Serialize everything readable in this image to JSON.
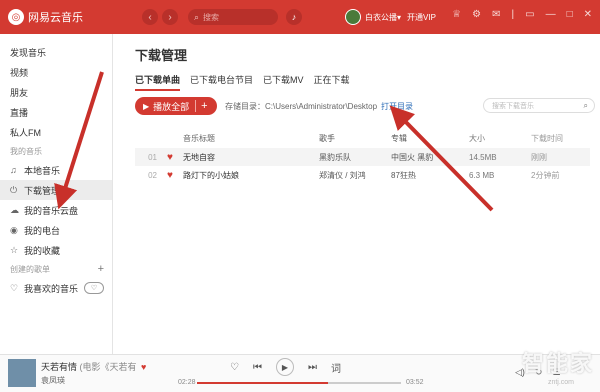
{
  "app": {
    "logo": "网易云音乐",
    "search_placeholder": "搜索",
    "user": "白衣公播",
    "vip": "开通VIP"
  },
  "icons": {
    "logo": "netease-logo-icon",
    "back": "chevron-left-icon",
    "forward": "chevron-right-icon"
  },
  "colors": {
    "brand": "#d33a31",
    "link": "#2f6fb8"
  },
  "sidebar": {
    "top": [
      {
        "label": "发现音乐"
      },
      {
        "label": "视频"
      },
      {
        "label": "朋友"
      },
      {
        "label": "直播"
      },
      {
        "label": "私人FM"
      }
    ],
    "my_music_head": "我的音乐",
    "my": [
      {
        "label": "本地音乐",
        "icon": "♫"
      },
      {
        "label": "下载管理",
        "icon": "⏻"
      },
      {
        "label": "我的音乐云盘",
        "icon": "☁"
      },
      {
        "label": "我的电台",
        "icon": "◉"
      },
      {
        "label": "我的收藏",
        "icon": "☆"
      }
    ],
    "created_head": "创建的歌单",
    "created_add": "+",
    "liked": "我喜欢的音乐"
  },
  "main": {
    "title": "下载管理",
    "tabs": [
      "已下载单曲",
      "已下载电台节目",
      "已下载MV",
      "正在下载"
    ],
    "play_all": "播放全部",
    "play_all_plus": "+",
    "path_text": "存储目录：C:\\Users\\Administrator\\Desktop",
    "open_dir": "打开目录",
    "search_placeholder": "搜索下载音乐",
    "columns": [
      "音乐标题",
      "歌手",
      "专辑",
      "大小",
      "下载时间"
    ],
    "rows": [
      {
        "num": "01",
        "title": "无地自容",
        "artist": "黑豹乐队",
        "album": "中国火 黑豹",
        "size": "14.5MB",
        "time": "刚刚"
      },
      {
        "num": "02",
        "title": "路灯下的小姑娘",
        "artist": "郑清仪 / 刘鸿",
        "album": "87狂热",
        "size": "6.3 MB",
        "time": "2分钟前"
      }
    ]
  },
  "player": {
    "song": "天若有情",
    "song_sub": "(电影《天若有",
    "singer": "袁凤瑛",
    "current": "02:28",
    "total": "03:52",
    "progress": 0.64,
    "lyric": "词"
  },
  "watermark": "智能家",
  "watermark_url": "zntj.com"
}
